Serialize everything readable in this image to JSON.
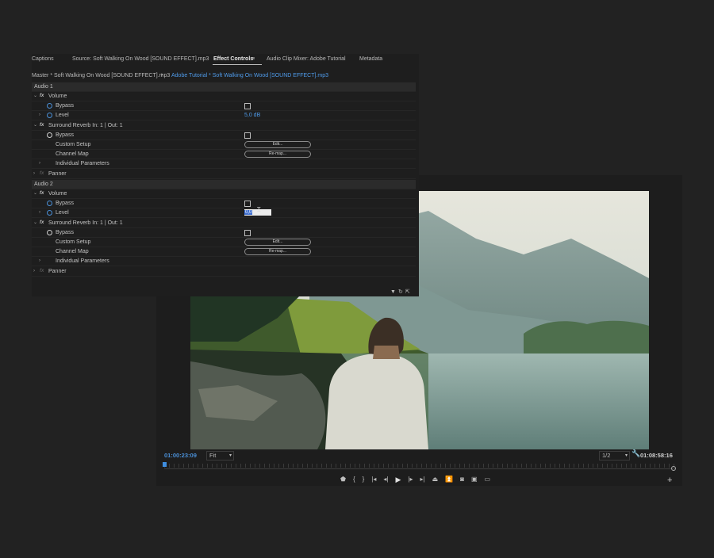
{
  "tabs": {
    "captions": "Captions",
    "source": "Source: Soft Walking On Wood [SOUND EFFECT].mp3",
    "effect_controls": "Effect Controls",
    "audio_clip_mixer": "Audio Clip Mixer: Adobe Tutorial",
    "metadata": "Metadata"
  },
  "clip_bar": {
    "master": "Master * Soft Walking On Wood [SOUND EFFECT].mp3",
    "arrow": "›",
    "sequence_clip": "Adobe Tutorial * Soft Walking On Wood [SOUND EFFECT].mp3"
  },
  "audio1": {
    "title": "Audio 1",
    "volume": "Volume",
    "bypass": "Bypass",
    "level": "Level",
    "level_value": "5,0 dB",
    "surround": "Surround Reverb In: 1 | Out: 1",
    "bypass2": "Bypass",
    "custom_setup": "Custom Setup",
    "edit_btn": "Edit...",
    "channel_map": "Channel Map",
    "remap_btn": "Re-map...",
    "individual": "Individual Parameters",
    "panner": "Panner"
  },
  "audio2": {
    "title": "Audio 2",
    "volume": "Volume",
    "bypass": "Bypass",
    "level": "Level",
    "level_value": "0,0",
    "surround": "Surround Reverb In: 1 | Out: 1",
    "bypass2": "Bypass",
    "custom_setup": "Custom Setup",
    "edit_btn": "Edit...",
    "channel_map": "Channel Map",
    "remap_btn": "Re-map...",
    "individual": "Individual Parameters",
    "panner": "Panner"
  },
  "monitor": {
    "timecode_current": "01:00:23:09",
    "zoom": "Fit",
    "resolution": "1/2",
    "timecode_duration": "01:08:58:16",
    "playhead_position": 0.0
  },
  "colors": {
    "accent_blue": "#4a8fd6",
    "panel_bg": "#1e1e1e",
    "app_bg": "#222222"
  },
  "icons": {
    "transport": [
      "add-marker-icon",
      "mark-in-icon",
      "mark-out-icon",
      "go-to-in-icon",
      "step-back-icon",
      "play-icon",
      "step-forward-icon",
      "go-to-out-icon",
      "lift-icon",
      "extract-icon",
      "export-frame-icon",
      "compare-icon",
      "overlay-icon"
    ]
  }
}
